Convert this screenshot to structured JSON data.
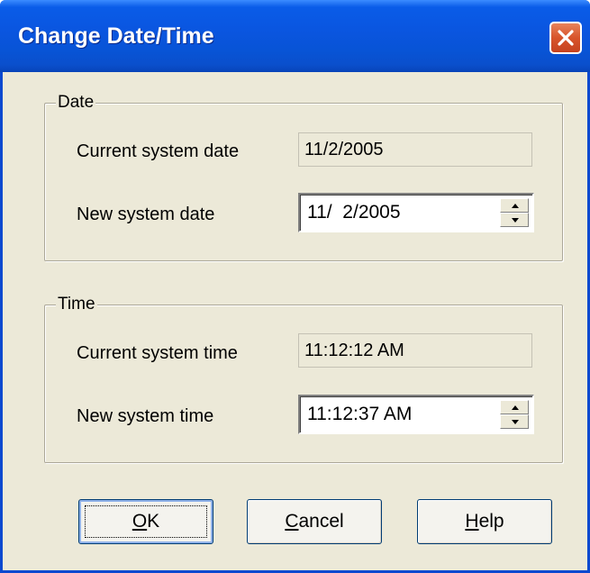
{
  "window": {
    "title": "Change Date/Time",
    "close_icon": "close-x-icon"
  },
  "date_group": {
    "legend": "Date",
    "current_label": "Current system date",
    "current_value": "11/2/2005",
    "new_label": "New system date",
    "new_value": "11/  2/2005"
  },
  "time_group": {
    "legend": "Time",
    "current_label": "Current system time",
    "current_value": "11:12:12 AM",
    "new_label": "New system time",
    "new_value": "11:12:37 AM"
  },
  "buttons": {
    "ok": {
      "mnemonic": "O",
      "rest": "K"
    },
    "cancel": {
      "mnemonic": "C",
      "rest": "ancel"
    },
    "help": {
      "mnemonic": "H",
      "rest": "elp"
    }
  },
  "colors": {
    "titlebar": "#0a55df",
    "close": "#d8542b",
    "face": "#ece9d8"
  }
}
